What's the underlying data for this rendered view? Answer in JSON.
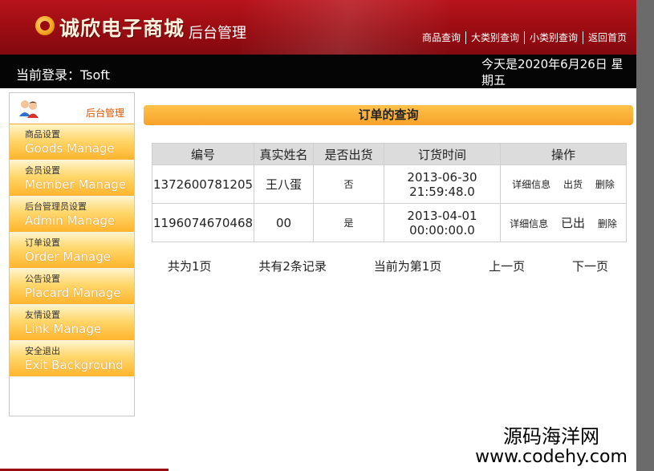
{
  "header": {
    "logo_text": "诚欣电子商城",
    "logo_sub": "后台管理",
    "nav": [
      "商品查询",
      "大类别查询",
      "小类别查询",
      "返回首页"
    ]
  },
  "loginbar": {
    "login": "当前登录：Tsoft",
    "date": "今天是2020年6月26日 星期五"
  },
  "sidebar": {
    "title": "后台管理",
    "items": [
      {
        "cn": "商品设置",
        "en": "Goods Manage"
      },
      {
        "cn": "会员设置",
        "en": "Member Manage"
      },
      {
        "cn": "后台管理员设置",
        "en": "Admin Manage"
      },
      {
        "cn": "订单设置",
        "en": "Order Manage"
      },
      {
        "cn": "公告设置",
        "en": "Placard Manage"
      },
      {
        "cn": "友情设置",
        "en": "Link Manage"
      },
      {
        "cn": "安全退出",
        "en": "Exit Background"
      }
    ]
  },
  "main": {
    "title": "订单的查询",
    "columns": [
      "编号",
      "真实姓名",
      "是否出货",
      "订货时间",
      "操作"
    ],
    "rows": [
      {
        "id": "1372600781205",
        "name": "王八蛋",
        "shipped": "否",
        "date": "2013-06-30",
        "time": "21:59:48.0",
        "ops": [
          "详细信息",
          "出货",
          "删除"
        ]
      },
      {
        "id": "1196074670468",
        "name": "00",
        "shipped": "是",
        "date": "2013-04-01",
        "time": "00:00:00.0",
        "ops": [
          "详细信息",
          "已出",
          "删除"
        ]
      }
    ],
    "pager": {
      "total_pages": "共为1页",
      "total_records": "共有2条记录",
      "current": "当前为第1页",
      "prev": "上一页",
      "next": "下一页"
    }
  },
  "watermark": {
    "line1": "源码海洋网",
    "line2": "www.codehy.com"
  }
}
